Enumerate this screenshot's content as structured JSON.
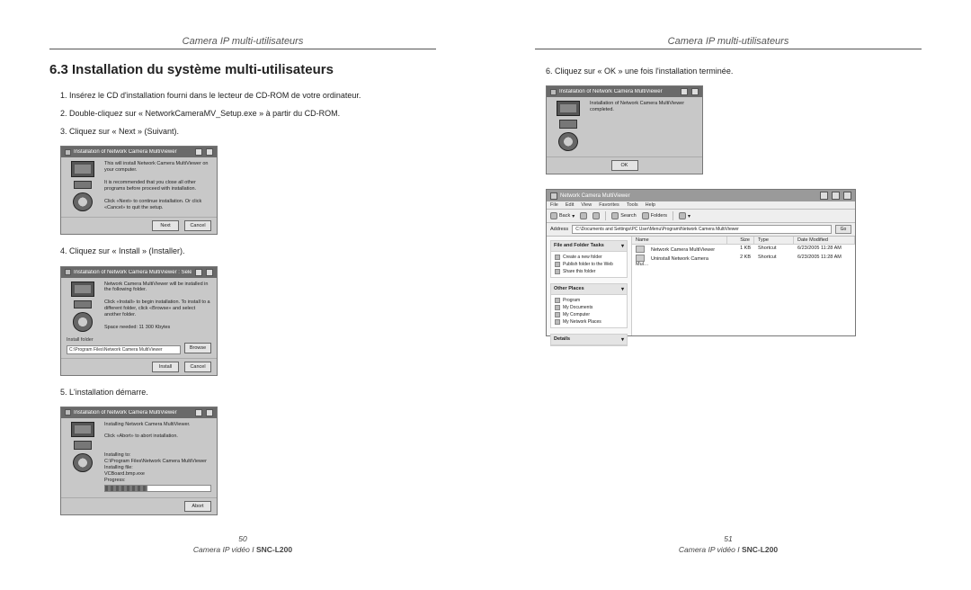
{
  "running_head": "Camera IP multi-utilisateurs",
  "section_title": "6.3 Installation du système multi-utilisateurs",
  "steps": {
    "s1": "1. Insérez le CD d'installation fourni dans le lecteur de CD-ROM de votre ordinateur.",
    "s2": "2. Double-cliquez sur « NetworkCameraMV_Setup.exe » à partir du CD-ROM.",
    "s3": "3. Cliquez sur « Next » (Suivant).",
    "s4": "4. Cliquez sur « Install » (Installer).",
    "s5": "5. L'installation démarre.",
    "s6": "6. Cliquez sur « OK » une fois l'installation terminée."
  },
  "dlg_common": {
    "title": "Installation of Network Camera MultiViewer"
  },
  "dlg3": {
    "msg1": "This will install Network Camera MultiViewer on your computer.",
    "msg2": "It is recommended that you close all other programs before proceed with installation.",
    "msg3": "Click «Next» to continue installation. Or click «Cancel» to quit the setup.",
    "btn_next": "Next",
    "btn_cancel": "Cancel"
  },
  "dlg4": {
    "title_suffix": "Select f…",
    "msg1": "Network Camera MultiViewer will be installed in the following folder.",
    "msg2": "Click «Install» to begin installation. To install to a different folder, click «Browse» and select another folder.",
    "space": "Space needed: 11 300 Kbytes",
    "folder_label": "Install folder",
    "folder_value": "C:\\Program Files\\Network Camera MultiViewer",
    "btn_browse": "Browse",
    "btn_install": "Install",
    "btn_cancel": "Cancel"
  },
  "dlg5": {
    "msg1": "Installing Network Camera MultiViewer.",
    "msg2": "Click «Abort» to abort installation.",
    "line_to": "Installing to:",
    "line_to_val": "C:\\Program Files\\Network Camera MultiViewer",
    "line_file": "Installing file:",
    "line_file_val": "VCBoard.bmp.exe",
    "progress_label": "Progress:",
    "btn_abort": "Abort"
  },
  "dlg6": {
    "msg": "Installation of Network Camera MultiViewer completed.",
    "btn_ok": "OK"
  },
  "explorer": {
    "title": "Network Camera MultiViewer",
    "menu": [
      "File",
      "Edit",
      "View",
      "Favorites",
      "Tools",
      "Help"
    ],
    "toolbar": {
      "back": "Back",
      "search": "Search",
      "folders": "Folders"
    },
    "address_label": "Address",
    "address_value": "C:\\Documents and Settings\\PC User\\Menu\\Program\\Network Camera MultiViewer",
    "go": "Go",
    "side": {
      "tasks_title": "File and Folder Tasks",
      "tasks": [
        "Create a new folder",
        "Publish folder to the Web",
        "Share this folder"
      ],
      "places_title": "Other Places",
      "places": [
        "Program",
        "My Documents",
        "My Computer",
        "My Network Places"
      ],
      "details_title": "Details"
    },
    "columns": {
      "name": "Name",
      "size": "Size",
      "type": "Type",
      "date": "Date Modified"
    },
    "rows": [
      {
        "name": "Network Camera MultiViewer",
        "size": "1 KB",
        "type": "Shortcut",
        "date": "6/23/2005 11:28 AM"
      },
      {
        "name": "Uninstall Network Camera Mul…",
        "size": "2 KB",
        "type": "Shortcut",
        "date": "6/23/2005 11:28 AM"
      }
    ]
  },
  "footer": {
    "page_left": "50",
    "page_right": "51",
    "line_prefix": "Camera IP vidéo I ",
    "model": "SNC-L200"
  },
  "chevron": "▾"
}
